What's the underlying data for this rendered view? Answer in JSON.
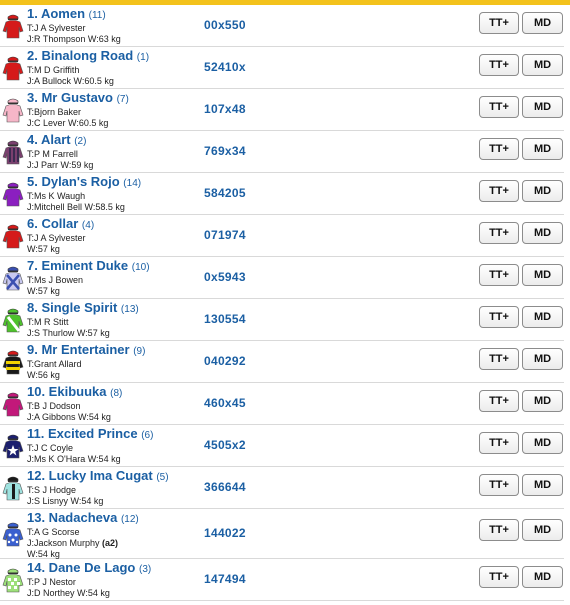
{
  "runners": [
    {
      "name": "1. Aomen",
      "draw": "(11)",
      "trainer": "T:J A Sylvester",
      "jockey": "J:R Thompson W:63 kg",
      "form": "00x550",
      "silk": {
        "c1": "#d51a1a",
        "c2": "#d51a1a",
        "cap": "#d51a1a",
        "pattern": "plain"
      }
    },
    {
      "name": "2. Binalong Road",
      "draw": "(1)",
      "trainer": "T:M D Griffith",
      "jockey": "J:A Bullock W:60.5 kg",
      "form": "52410x",
      "silk": {
        "c1": "#d51a1a",
        "c2": "#222222",
        "cap": "#d51a1a",
        "pattern": "plain"
      }
    },
    {
      "name": "3. Mr Gustavo",
      "draw": "(7)",
      "trainer": "T:Bjorn Baker",
      "jockey": "J:C Lever W:60.5 kg",
      "form": "107x48",
      "silk": {
        "c1": "#f6b6c8",
        "c2": "#ffffff",
        "cap": "#f6b6c8",
        "pattern": "plain"
      }
    },
    {
      "name": "4. Alart",
      "draw": "(2)",
      "trainer": "T:P M Farrell",
      "jockey": "J:J Parr W:59 kg",
      "form": "769x34",
      "silk": {
        "c1": "#7a3f6e",
        "c2": "#3a2a50",
        "cap": "#7a3f6e",
        "pattern": "stripes"
      }
    },
    {
      "name": "5. Dylan's Rojo",
      "draw": "(14)",
      "trainer": "T:Ms K Waugh",
      "jockey": "J:Mitchell Bell W:58.5 kg",
      "form": "584205",
      "silk": {
        "c1": "#8b1fc0",
        "c2": "#8b1fc0",
        "cap": "#8b1fc0",
        "pattern": "plain"
      }
    },
    {
      "name": "6. Collar",
      "draw": "(4)",
      "trainer": "T:J A Sylvester",
      "jockey": "W:57 kg",
      "form": "071974",
      "silk": {
        "c1": "#d51a1a",
        "c2": "#d51a1a",
        "cap": "#d51a1a",
        "pattern": "plain"
      }
    },
    {
      "name": "7. Eminent Duke",
      "draw": "(10)",
      "trainer": "T:Ms J Bowen",
      "jockey": "W:57 kg",
      "form": "0x5943",
      "silk": {
        "c1": "#c8c8f0",
        "c2": "#3a4fb0",
        "cap": "#3a4fb0",
        "pattern": "cross"
      }
    },
    {
      "name": "8. Single Spirit",
      "draw": "(13)",
      "trainer": "T:M R Stitt",
      "jockey": "J:S Thurlow W:57 kg",
      "form": "130554",
      "silk": {
        "c1": "#4ec22c",
        "c2": "#ffffff",
        "cap": "#4ec22c",
        "pattern": "sash"
      }
    },
    {
      "name": "9. Mr Entertainer",
      "draw": "(9)",
      "trainer": "T:Grant Allard",
      "jockey": "W:56 kg",
      "form": "040292",
      "silk": {
        "c1": "#1a1a1a",
        "c2": "#f2d200",
        "cap": "#d51a1a",
        "pattern": "hoops"
      }
    },
    {
      "name": "10. Ekibuuka",
      "draw": "(8)",
      "trainer": "T:B J Dodson",
      "jockey": "J:A Gibbons W:54 kg",
      "form": "460x45",
      "silk": {
        "c1": "#c2187a",
        "c2": "#c2187a",
        "cap": "#c2187a",
        "pattern": "plain"
      }
    },
    {
      "name": "11. Excited Prince",
      "draw": "(6)",
      "trainer": "T:J C Coyle",
      "jockey": "J:Ms K O'Hara W:54 kg",
      "form": "4505x2",
      "silk": {
        "c1": "#1b1f6e",
        "c2": "#ffffff",
        "cap": "#1b1f6e",
        "pattern": "star"
      }
    },
    {
      "name": "12. Lucky Ima Cugat",
      "draw": "(5)",
      "trainer": "T:S J Hodge",
      "jockey": "J:S Lisnyy W:54 kg",
      "form": "366644",
      "silk": {
        "c1": "#9fe3e0",
        "c2": "#1a1a1a",
        "cap": "#1a1a1a",
        "pattern": "stripe"
      }
    },
    {
      "name": "13. Nadacheva",
      "draw": "(12)",
      "trainer": "T:A G Scorse",
      "jockey": "J:Jackson Murphy",
      "claim": "(a2)",
      "weight": "W:54 kg",
      "form": "144022",
      "silk": {
        "c1": "#3a5fcf",
        "c2": "#ffffff",
        "cap": "#3a5fcf",
        "pattern": "spots"
      }
    },
    {
      "name": "14. Dane De Lago",
      "draw": "(3)",
      "trainer": "T:P J Nestor",
      "jockey": "J:D Northey W:54 kg",
      "form": "147494",
      "silk": {
        "c1": "#9de07a",
        "c2": "#ffffff",
        "cap": "#9de07a",
        "pattern": "check"
      }
    }
  ],
  "buttons": {
    "tt_label": "TT+",
    "md_label": "MD"
  },
  "colors": {
    "accent": "#f3c21c",
    "link": "#1b5fa3"
  }
}
